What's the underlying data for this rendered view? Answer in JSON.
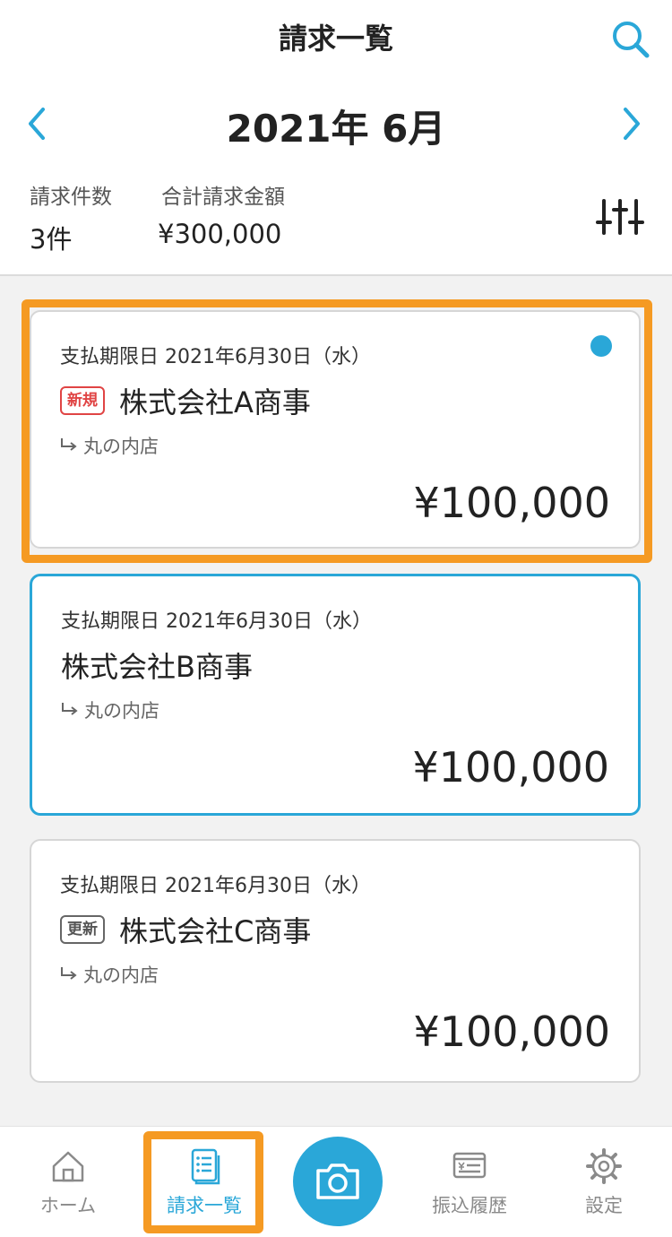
{
  "header": {
    "title": "請求一覧",
    "month": "2021年 6月"
  },
  "summary": {
    "count_label": "請求件数",
    "count_value": "3件",
    "total_label": "合計請求金額",
    "total_value": "¥300,000"
  },
  "invoices": [
    {
      "due": "支払期限日 2021年6月30日（水）",
      "badge": "新規",
      "company": "株式会社A商事",
      "branch": "丸の内店",
      "amount": "¥100,000"
    },
    {
      "due": "支払期限日 2021年6月30日（水）",
      "badge": "",
      "company": "株式会社B商事",
      "branch": "丸の内店",
      "amount": "¥100,000"
    },
    {
      "due": "支払期限日 2021年6月30日（水）",
      "badge": "更新",
      "company": "株式会社C商事",
      "branch": "丸の内店",
      "amount": "¥100,000"
    }
  ],
  "tabs": {
    "home": "ホーム",
    "invoices": "請求一覧",
    "transfers": "振込履歴",
    "settings": "設定"
  },
  "icons": {
    "search": "search-icon",
    "prev": "chevron-left-icon",
    "next": "chevron-right-icon",
    "filter": "sliders-icon",
    "branch": "subdirectory-arrow-icon",
    "home": "home-icon",
    "invoices": "document-list-icon",
    "camera": "camera-icon",
    "transfers": "transfer-receipt-icon",
    "settings": "gear-icon"
  },
  "colors": {
    "accent": "#2aa7d8",
    "highlight": "#f59a23",
    "new_badge": "#e04444"
  }
}
